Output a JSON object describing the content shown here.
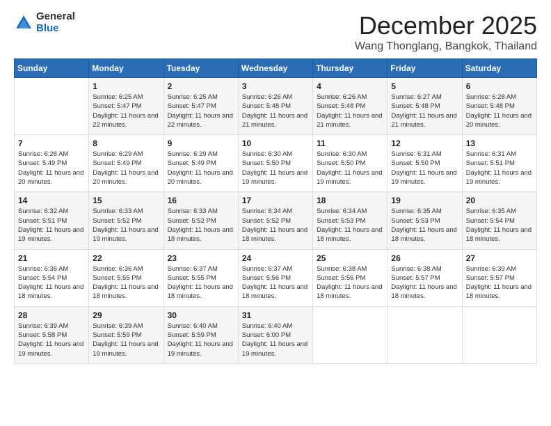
{
  "logo": {
    "general": "General",
    "blue": "Blue"
  },
  "title": "December 2025",
  "location": "Wang Thonglang, Bangkok, Thailand",
  "headers": [
    "Sunday",
    "Monday",
    "Tuesday",
    "Wednesday",
    "Thursday",
    "Friday",
    "Saturday"
  ],
  "weeks": [
    [
      {
        "day": "",
        "sunrise": "",
        "sunset": "",
        "daylight": ""
      },
      {
        "day": "1",
        "sunrise": "Sunrise: 6:25 AM",
        "sunset": "Sunset: 5:47 PM",
        "daylight": "Daylight: 11 hours and 22 minutes."
      },
      {
        "day": "2",
        "sunrise": "Sunrise: 6:25 AM",
        "sunset": "Sunset: 5:47 PM",
        "daylight": "Daylight: 11 hours and 22 minutes."
      },
      {
        "day": "3",
        "sunrise": "Sunrise: 6:26 AM",
        "sunset": "Sunset: 5:48 PM",
        "daylight": "Daylight: 11 hours and 21 minutes."
      },
      {
        "day": "4",
        "sunrise": "Sunrise: 6:26 AM",
        "sunset": "Sunset: 5:48 PM",
        "daylight": "Daylight: 11 hours and 21 minutes."
      },
      {
        "day": "5",
        "sunrise": "Sunrise: 6:27 AM",
        "sunset": "Sunset: 5:48 PM",
        "daylight": "Daylight: 11 hours and 21 minutes."
      },
      {
        "day": "6",
        "sunrise": "Sunrise: 6:28 AM",
        "sunset": "Sunset: 5:48 PM",
        "daylight": "Daylight: 11 hours and 20 minutes."
      }
    ],
    [
      {
        "day": "7",
        "sunrise": "Sunrise: 6:28 AM",
        "sunset": "Sunset: 5:49 PM",
        "daylight": "Daylight: 11 hours and 20 minutes."
      },
      {
        "day": "8",
        "sunrise": "Sunrise: 6:29 AM",
        "sunset": "Sunset: 5:49 PM",
        "daylight": "Daylight: 11 hours and 20 minutes."
      },
      {
        "day": "9",
        "sunrise": "Sunrise: 6:29 AM",
        "sunset": "Sunset: 5:49 PM",
        "daylight": "Daylight: 11 hours and 20 minutes."
      },
      {
        "day": "10",
        "sunrise": "Sunrise: 6:30 AM",
        "sunset": "Sunset: 5:50 PM",
        "daylight": "Daylight: 11 hours and 19 minutes."
      },
      {
        "day": "11",
        "sunrise": "Sunrise: 6:30 AM",
        "sunset": "Sunset: 5:50 PM",
        "daylight": "Daylight: 11 hours and 19 minutes."
      },
      {
        "day": "12",
        "sunrise": "Sunrise: 6:31 AM",
        "sunset": "Sunset: 5:50 PM",
        "daylight": "Daylight: 11 hours and 19 minutes."
      },
      {
        "day": "13",
        "sunrise": "Sunrise: 6:31 AM",
        "sunset": "Sunset: 5:51 PM",
        "daylight": "Daylight: 11 hours and 19 minutes."
      }
    ],
    [
      {
        "day": "14",
        "sunrise": "Sunrise: 6:32 AM",
        "sunset": "Sunset: 5:51 PM",
        "daylight": "Daylight: 11 hours and 19 minutes."
      },
      {
        "day": "15",
        "sunrise": "Sunrise: 6:33 AM",
        "sunset": "Sunset: 5:52 PM",
        "daylight": "Daylight: 11 hours and 19 minutes."
      },
      {
        "day": "16",
        "sunrise": "Sunrise: 6:33 AM",
        "sunset": "Sunset: 5:52 PM",
        "daylight": "Daylight: 11 hours and 18 minutes."
      },
      {
        "day": "17",
        "sunrise": "Sunrise: 6:34 AM",
        "sunset": "Sunset: 5:52 PM",
        "daylight": "Daylight: 11 hours and 18 minutes."
      },
      {
        "day": "18",
        "sunrise": "Sunrise: 6:34 AM",
        "sunset": "Sunset: 5:53 PM",
        "daylight": "Daylight: 11 hours and 18 minutes."
      },
      {
        "day": "19",
        "sunrise": "Sunrise: 6:35 AM",
        "sunset": "Sunset: 5:53 PM",
        "daylight": "Daylight: 11 hours and 18 minutes."
      },
      {
        "day": "20",
        "sunrise": "Sunrise: 6:35 AM",
        "sunset": "Sunset: 5:54 PM",
        "daylight": "Daylight: 11 hours and 18 minutes."
      }
    ],
    [
      {
        "day": "21",
        "sunrise": "Sunrise: 6:36 AM",
        "sunset": "Sunset: 5:54 PM",
        "daylight": "Daylight: 11 hours and 18 minutes."
      },
      {
        "day": "22",
        "sunrise": "Sunrise: 6:36 AM",
        "sunset": "Sunset: 5:55 PM",
        "daylight": "Daylight: 11 hours and 18 minutes."
      },
      {
        "day": "23",
        "sunrise": "Sunrise: 6:37 AM",
        "sunset": "Sunset: 5:55 PM",
        "daylight": "Daylight: 11 hours and 18 minutes."
      },
      {
        "day": "24",
        "sunrise": "Sunrise: 6:37 AM",
        "sunset": "Sunset: 5:56 PM",
        "daylight": "Daylight: 11 hours and 18 minutes."
      },
      {
        "day": "25",
        "sunrise": "Sunrise: 6:38 AM",
        "sunset": "Sunset: 5:56 PM",
        "daylight": "Daylight: 11 hours and 18 minutes."
      },
      {
        "day": "26",
        "sunrise": "Sunrise: 6:38 AM",
        "sunset": "Sunset: 5:57 PM",
        "daylight": "Daylight: 11 hours and 18 minutes."
      },
      {
        "day": "27",
        "sunrise": "Sunrise: 6:39 AM",
        "sunset": "Sunset: 5:57 PM",
        "daylight": "Daylight: 11 hours and 18 minutes."
      }
    ],
    [
      {
        "day": "28",
        "sunrise": "Sunrise: 6:39 AM",
        "sunset": "Sunset: 5:58 PM",
        "daylight": "Daylight: 11 hours and 19 minutes."
      },
      {
        "day": "29",
        "sunrise": "Sunrise: 6:39 AM",
        "sunset": "Sunset: 5:59 PM",
        "daylight": "Daylight: 11 hours and 19 minutes."
      },
      {
        "day": "30",
        "sunrise": "Sunrise: 6:40 AM",
        "sunset": "Sunset: 5:59 PM",
        "daylight": "Daylight: 11 hours and 19 minutes."
      },
      {
        "day": "31",
        "sunrise": "Sunrise: 6:40 AM",
        "sunset": "Sunset: 6:00 PM",
        "daylight": "Daylight: 11 hours and 19 minutes."
      },
      {
        "day": "",
        "sunrise": "",
        "sunset": "",
        "daylight": ""
      },
      {
        "day": "",
        "sunrise": "",
        "sunset": "",
        "daylight": ""
      },
      {
        "day": "",
        "sunrise": "",
        "sunset": "",
        "daylight": ""
      }
    ]
  ]
}
